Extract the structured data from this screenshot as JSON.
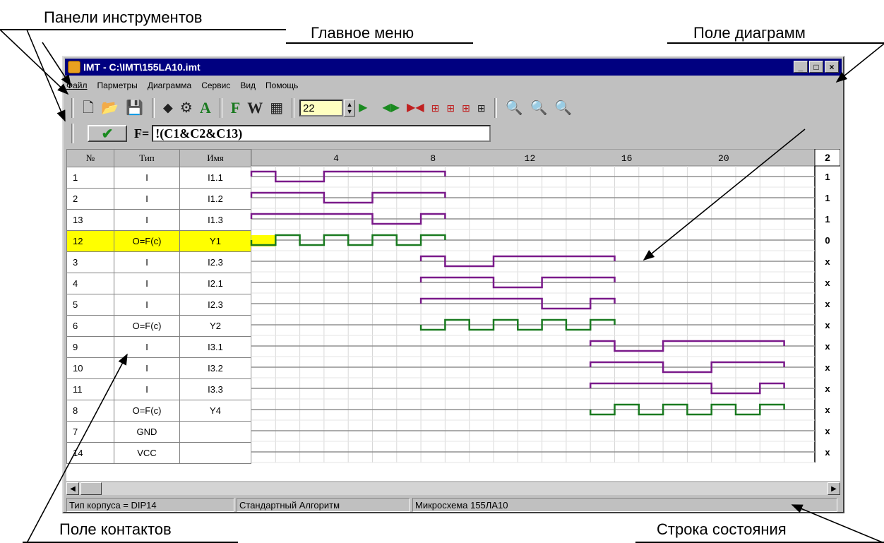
{
  "annotations": {
    "toolbars": "Панели инструментов",
    "main_menu": "Главное меню",
    "diagram_field": "Поле диаграмм",
    "contacts_field": "Поле контактов",
    "status_line": "Строка состояния"
  },
  "window": {
    "title": "IMT - C:\\IMT\\155LA10.imt"
  },
  "menu": [
    "Файл",
    "Парметры",
    "Диаграмма",
    "Сервис",
    "Вид",
    "Помощь"
  ],
  "toolbar": {
    "step_value": "22"
  },
  "formula": {
    "label": "F=",
    "value": "!(C1&C2&C13)"
  },
  "table": {
    "headers": [
      "№",
      "Тип",
      "Имя"
    ],
    "rows": [
      {
        "num": "1",
        "type": "I",
        "name": "I1.1",
        "state": "1",
        "highlight": false
      },
      {
        "num": "2",
        "type": "I",
        "name": "I1.2",
        "state": "1",
        "highlight": false
      },
      {
        "num": "13",
        "type": "I",
        "name": "I1.3",
        "state": "1",
        "highlight": false
      },
      {
        "num": "12",
        "type": "O=F(c)",
        "name": "Y1",
        "state": "0",
        "highlight": true
      },
      {
        "num": "3",
        "type": "I",
        "name": "I2.3",
        "state": "x",
        "highlight": false
      },
      {
        "num": "4",
        "type": "I",
        "name": "I2.1",
        "state": "x",
        "highlight": false
      },
      {
        "num": "5",
        "type": "I",
        "name": "I2.3",
        "state": "x",
        "highlight": false
      },
      {
        "num": "6",
        "type": "O=F(c)",
        "name": "Y2",
        "state": "x",
        "highlight": false
      },
      {
        "num": "9",
        "type": "I",
        "name": "I3.1",
        "state": "x",
        "highlight": false
      },
      {
        "num": "10",
        "type": "I",
        "name": "I3.2",
        "state": "x",
        "highlight": false
      },
      {
        "num": "11",
        "type": "I",
        "name": "I3.3",
        "state": "x",
        "highlight": false
      },
      {
        "num": "8",
        "type": "O=F(c)",
        "name": "Y4",
        "state": "x",
        "highlight": false
      },
      {
        "num": "7",
        "type": "GND",
        "name": "",
        "state": "x",
        "highlight": false
      },
      {
        "num": "14",
        "type": "VCC",
        "name": "",
        "state": "x",
        "highlight": false
      }
    ]
  },
  "timeline": {
    "ticks": [
      "4",
      "8",
      "12",
      "16",
      "20"
    ],
    "state_column_header": "2"
  },
  "signals": [
    {
      "row": 0,
      "color": "#7a1a8a",
      "from": 1,
      "to": 8,
      "low": [
        2,
        3
      ]
    },
    {
      "row": 1,
      "color": "#7a1a8a",
      "from": 1,
      "to": 8,
      "low": [
        4,
        5
      ]
    },
    {
      "row": 2,
      "color": "#7a1a8a",
      "from": 1,
      "to": 8,
      "low": [
        6,
        7
      ]
    },
    {
      "row": 3,
      "color": "#1a7a20",
      "from": 1,
      "to": 8,
      "low": [
        1,
        3,
        5,
        7
      ],
      "mark_cell": 1
    },
    {
      "row": 4,
      "color": "#7a1a8a",
      "from": 8,
      "to": 15,
      "low": [
        9,
        10
      ]
    },
    {
      "row": 5,
      "color": "#7a1a8a",
      "from": 8,
      "to": 15,
      "low": [
        11,
        12
      ]
    },
    {
      "row": 6,
      "color": "#7a1a8a",
      "from": 8,
      "to": 15,
      "low": [
        13,
        14
      ]
    },
    {
      "row": 7,
      "color": "#1a7a20",
      "from": 8,
      "to": 15,
      "low": [
        8,
        10,
        12,
        14
      ]
    },
    {
      "row": 8,
      "color": "#7a1a8a",
      "from": 15,
      "to": 22,
      "low": [
        16,
        17
      ]
    },
    {
      "row": 9,
      "color": "#7a1a8a",
      "from": 15,
      "to": 22,
      "low": [
        18,
        19
      ]
    },
    {
      "row": 10,
      "color": "#7a1a8a",
      "from": 15,
      "to": 22,
      "low": [
        20,
        21
      ]
    },
    {
      "row": 11,
      "color": "#1a7a20",
      "from": 15,
      "to": 22,
      "low": [
        15,
        17,
        19,
        21
      ]
    }
  ],
  "status": {
    "package": "Тип корпуса = DIP14",
    "algorithm": "Стандартный Алгоритм",
    "chip": "Микросхема 155ЛА10"
  }
}
